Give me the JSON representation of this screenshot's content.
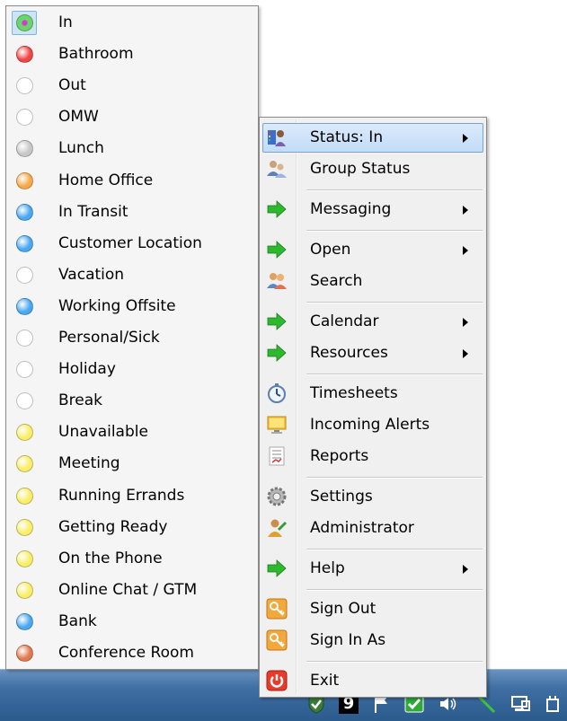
{
  "status_menu": {
    "items": [
      {
        "label": "In",
        "color": "#6cd46c",
        "selected": true
      },
      {
        "label": "Bathroom",
        "color": "#f04545"
      },
      {
        "label": "Out",
        "color": "#ffffff"
      },
      {
        "label": "OMW",
        "color": "#ffffff"
      },
      {
        "label": "Lunch",
        "color": "#c8c8c8"
      },
      {
        "label": "Home Office",
        "color": "#f7a94a"
      },
      {
        "label": "In Transit",
        "color": "#4aa8f0"
      },
      {
        "label": "Customer Location",
        "color": "#4aa8f0"
      },
      {
        "label": "Vacation",
        "color": "#ffffff"
      },
      {
        "label": "Working Offsite",
        "color": "#4aa8f0"
      },
      {
        "label": "Personal/Sick",
        "color": "#ffffff"
      },
      {
        "label": "Holiday",
        "color": "#ffffff"
      },
      {
        "label": "Break",
        "color": "#ffffff"
      },
      {
        "label": "Unavailable",
        "color": "#f8ee68"
      },
      {
        "label": "Meeting",
        "color": "#f8ee68"
      },
      {
        "label": "Running Errands",
        "color": "#f8ee68"
      },
      {
        "label": "Getting Ready",
        "color": "#f8ee68"
      },
      {
        "label": "On the Phone",
        "color": "#f8ee68"
      },
      {
        "label": "Online Chat / GTM",
        "color": "#f8ee68"
      },
      {
        "label": "Bank",
        "color": "#4aa8f0"
      },
      {
        "label": "Conference Room",
        "color": "#e07a50"
      }
    ]
  },
  "main_menu": {
    "items": [
      {
        "label": "Status: In",
        "icon": "status-icon",
        "submenu": true,
        "hover": true
      },
      {
        "label": "Group Status",
        "icon": "group-status-icon"
      },
      {
        "label": "Messaging",
        "icon": "green-arrow-icon",
        "submenu": true
      },
      {
        "label": "Open",
        "icon": "green-arrow-icon",
        "submenu": true
      },
      {
        "label": "Search",
        "icon": "search-people-icon"
      },
      {
        "label": "Calendar",
        "icon": "green-arrow-icon",
        "submenu": true
      },
      {
        "label": "Resources",
        "icon": "green-arrow-icon",
        "submenu": true
      },
      {
        "label": "Timesheets",
        "icon": "stopwatch-icon"
      },
      {
        "label": "Incoming Alerts",
        "icon": "alert-monitor-icon"
      },
      {
        "label": "Reports",
        "icon": "report-icon"
      },
      {
        "label": "Settings",
        "icon": "gear-icon"
      },
      {
        "label": "Administrator",
        "icon": "administrator-icon"
      },
      {
        "label": "Help",
        "icon": "green-arrow-icon",
        "submenu": true
      },
      {
        "label": "Sign Out",
        "icon": "key-icon"
      },
      {
        "label": "Sign In As",
        "icon": "key-icon"
      },
      {
        "label": "Exit",
        "icon": "power-icon"
      }
    ]
  },
  "taskbar": {
    "tray_number": "9",
    "tray_icons": [
      "shield-check-icon",
      "flag-icon",
      "green-check-icon",
      "speaker-icon",
      "signal-icon",
      "network-icon",
      "power-plug-icon"
    ]
  }
}
